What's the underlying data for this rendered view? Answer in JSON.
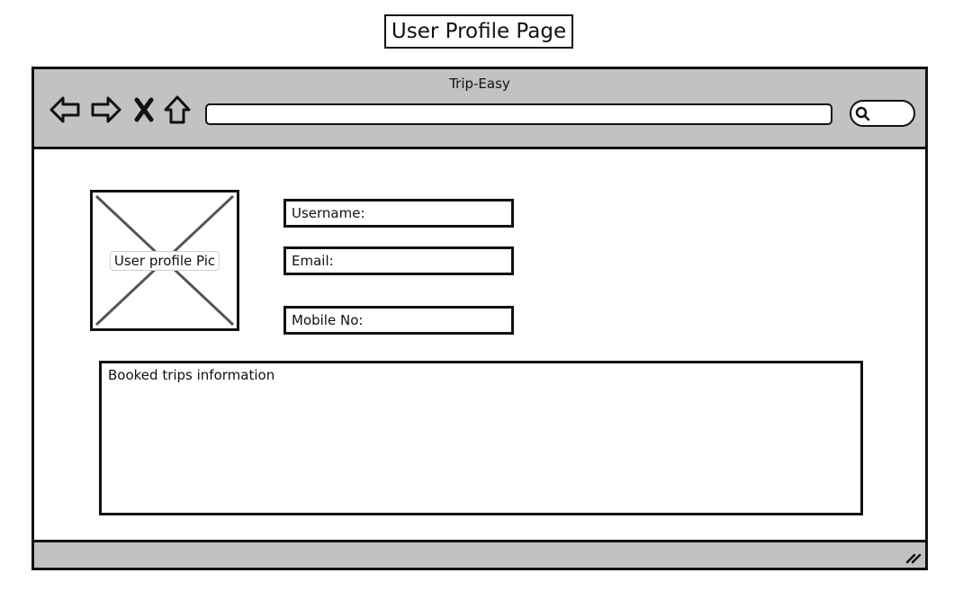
{
  "page": {
    "title": "User Profile Page"
  },
  "browser": {
    "window_title": "Trip-Easy",
    "url_value": "",
    "icons": {
      "back": "arrow-left-icon",
      "forward": "arrow-right-icon",
      "stop": "close-icon",
      "home": "home-icon",
      "search": "search-icon",
      "resize": "resize-grip-icon"
    }
  },
  "profile": {
    "picture_label": "User profile Pic",
    "fields": {
      "username_label": "Username:",
      "email_label": "Email:",
      "mobile_label": "Mobile No:"
    },
    "trips_label": "Booked trips information"
  },
  "colors": {
    "chrome": "#c2c2c2",
    "stroke": "#111111",
    "placeholder_x": "#555555"
  }
}
